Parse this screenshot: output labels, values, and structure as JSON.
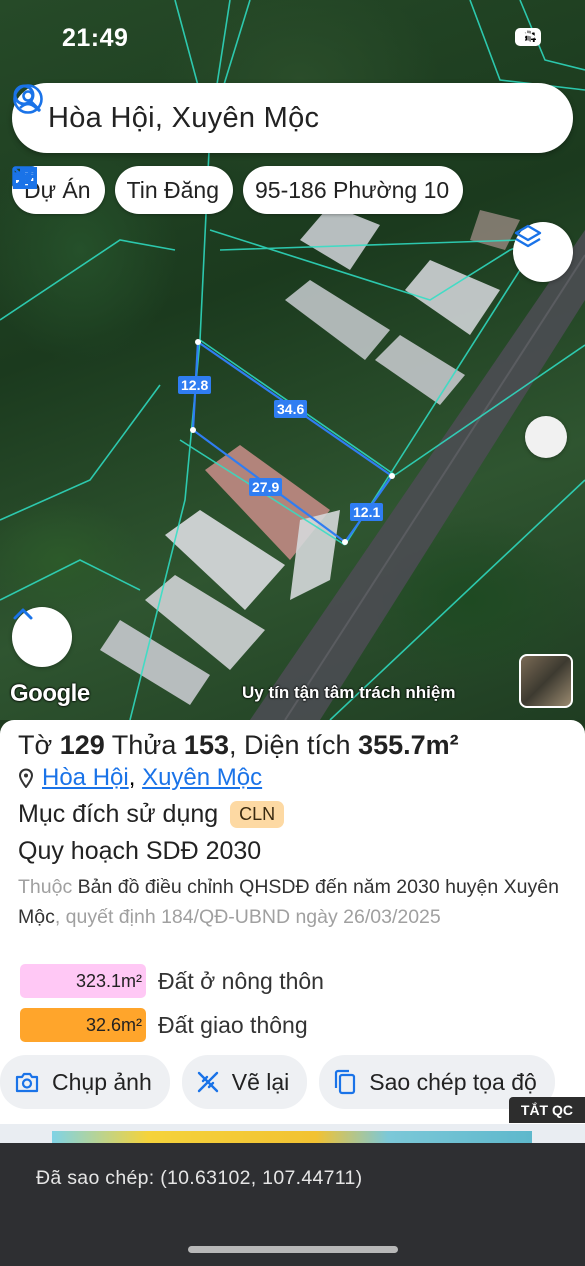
{
  "status": {
    "time": "21:49",
    "battery": "94"
  },
  "search": {
    "text": "Hòa Hội, Xuyên Mộc"
  },
  "chips": [
    {
      "label": "Dự Án",
      "icon": "building-icon"
    },
    {
      "label": "Tin Đăng",
      "icon": "listing-icon"
    },
    {
      "label": "95-186 Phường 10",
      "icon": "ruler-icon"
    }
  ],
  "map": {
    "dimensions": [
      "12.8",
      "34.6",
      "27.9",
      "12.1"
    ],
    "logo": "Google",
    "slogan": "Uy tín tận tâm trách nhiệm"
  },
  "parcel": {
    "to_label": "Tờ",
    "to_value": "129",
    "thua_label": "Thửa",
    "thua_value": "153",
    "area_label": ", Diện tích",
    "area_value": "355.7m²",
    "commune": "Hòa Hội",
    "sep": ",",
    "district": "Xuyên Mộc",
    "purpose_label": "Mục đích sử dụng",
    "purpose_code": "CLN",
    "plan_title": "Quy hoạch SDĐ 2030",
    "desc_prefix": "Thuộc",
    "desc_doc": "Bản đồ điều chỉnh QHSDĐ đến năm 2030 huyện Xuyên Mộc",
    "desc_suffix": ", quyết định 184/QĐ-UBND ngày 26/03/2025",
    "land_uses": [
      {
        "area": "323.1m²",
        "name": "Đất ở nông thôn",
        "color": "#ffc8f5"
      },
      {
        "area": "32.6m²",
        "name": "Đất giao thông",
        "color": "#ffa52b"
      }
    ]
  },
  "actions": [
    {
      "label": "Chụp ảnh",
      "icon": "camera-icon"
    },
    {
      "label": "Vẽ lại",
      "icon": "redraw-icon"
    },
    {
      "label": "Sao chép tọa độ",
      "icon": "copy-icon"
    }
  ],
  "ad": {
    "off_label": "TẮT QC"
  },
  "toast": {
    "text": "Đã sao chép: (10.63102, 107.44711)"
  },
  "colors": {
    "accent": "#1a73e8",
    "parcel_line": "#2f7df2"
  }
}
